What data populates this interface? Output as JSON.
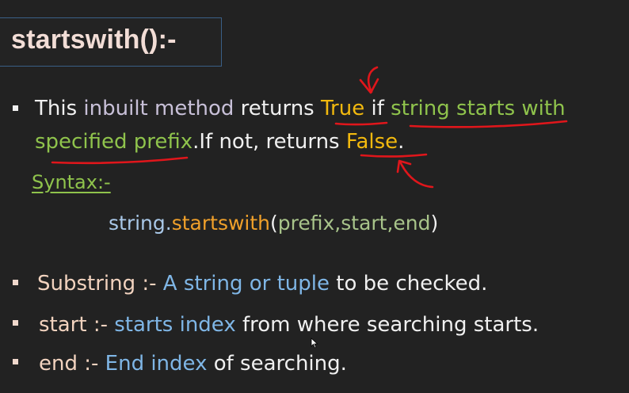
{
  "title": "startswith():-",
  "bullet1": {
    "line1": {
      "this": "This ",
      "inbuilt_method": "inbuilt method",
      "returns": " returns ",
      "true_word": "True",
      "if_word": " if ",
      "phrase": "string starts with"
    },
    "line2": {
      "specified_prefix": "specified prefix",
      "if_not": ".If not, returns ",
      "false_word": "False",
      "period": "."
    }
  },
  "syntax_label": "Syntax:-",
  "code": {
    "obj": "string",
    "dot": ".",
    "method": "startswith",
    "open": "(",
    "args": "prefix,start,end",
    "close": ")"
  },
  "params": [
    {
      "name": "Substring",
      "sep": " :- ",
      "desc_highlight": "A string or tuple",
      "desc_rest": " to be checked."
    },
    {
      "name": "start",
      "sep": " :- ",
      "desc_highlight": "starts index",
      "desc_rest": " from where searching starts."
    },
    {
      "name": "end",
      "sep": " :- ",
      "desc_highlight": "End index",
      "desc_rest": " of searching."
    }
  ],
  "colors": {
    "background": "#222222",
    "title": "#f2ddd6",
    "keyword_yellow": "#f2b90e",
    "keyword_green": "#8fc34c",
    "annotation_red": "#e0161b"
  }
}
